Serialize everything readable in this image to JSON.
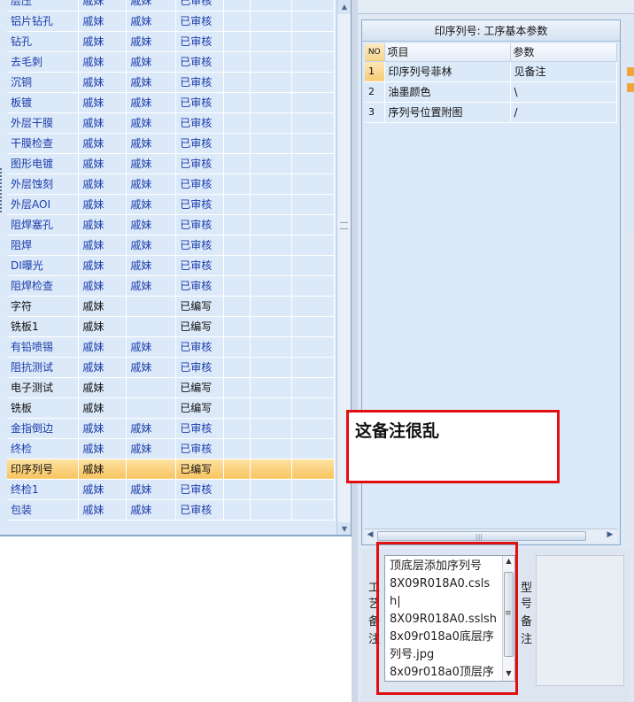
{
  "process_table": {
    "rows": [
      {
        "name": "层压",
        "c2": "戚妹",
        "c3": "戚妹",
        "status": "已审核",
        "kind": "approved",
        "selected": false
      },
      {
        "name": "铝片钻孔",
        "c2": "戚妹",
        "c3": "戚妹",
        "status": "已审核",
        "kind": "approved",
        "selected": false
      },
      {
        "name": "钻孔",
        "c2": "戚妹",
        "c3": "戚妹",
        "status": "已审核",
        "kind": "approved",
        "selected": false
      },
      {
        "name": "去毛刺",
        "c2": "戚妹",
        "c3": "戚妹",
        "status": "已审核",
        "kind": "approved",
        "selected": false
      },
      {
        "name": "沉铜",
        "c2": "戚妹",
        "c3": "戚妹",
        "status": "已审核",
        "kind": "approved",
        "selected": false
      },
      {
        "name": "板镀",
        "c2": "戚妹",
        "c3": "戚妹",
        "status": "已审核",
        "kind": "approved",
        "selected": false
      },
      {
        "name": "外层干膜",
        "c2": "戚妹",
        "c3": "戚妹",
        "status": "已审核",
        "kind": "approved",
        "selected": false
      },
      {
        "name": "干膜检查",
        "c2": "戚妹",
        "c3": "戚妹",
        "status": "已审核",
        "kind": "approved",
        "selected": false
      },
      {
        "name": "图形电镀",
        "c2": "戚妹",
        "c3": "戚妹",
        "status": "已审核",
        "kind": "approved",
        "selected": false
      },
      {
        "name": "外层蚀刻",
        "c2": "戚妹",
        "c3": "戚妹",
        "status": "已审核",
        "kind": "approved",
        "selected": false
      },
      {
        "name": "外层AOI",
        "c2": "戚妹",
        "c3": "戚妹",
        "status": "已审核",
        "kind": "approved",
        "selected": false
      },
      {
        "name": "阻焊塞孔",
        "c2": "戚妹",
        "c3": "戚妹",
        "status": "已审核",
        "kind": "approved",
        "selected": false
      },
      {
        "name": "阻焊",
        "c2": "戚妹",
        "c3": "戚妹",
        "status": "已审核",
        "kind": "approved",
        "selected": false
      },
      {
        "name": "DI曝光",
        "c2": "戚妹",
        "c3": "戚妹",
        "status": "已审核",
        "kind": "approved",
        "selected": false
      },
      {
        "name": "阻焊检查",
        "c2": "戚妹",
        "c3": "戚妹",
        "status": "已审核",
        "kind": "approved",
        "selected": false
      },
      {
        "name": "字符",
        "c2": "戚妹",
        "c3": "",
        "status": "已编写",
        "kind": "written",
        "selected": false
      },
      {
        "name": "铣板1",
        "c2": "戚妹",
        "c3": "",
        "status": "已编写",
        "kind": "written",
        "selected": false
      },
      {
        "name": "有铅喷锡",
        "c2": "戚妹",
        "c3": "戚妹",
        "status": "已审核",
        "kind": "approved",
        "selected": false
      },
      {
        "name": "阻抗测试",
        "c2": "戚妹",
        "c3": "戚妹",
        "status": "已审核",
        "kind": "approved",
        "selected": false
      },
      {
        "name": "电子测试",
        "c2": "戚妹",
        "c3": "",
        "status": "已编写",
        "kind": "written",
        "selected": false
      },
      {
        "name": "铣板",
        "c2": "戚妹",
        "c3": "",
        "status": "已编写",
        "kind": "written",
        "selected": false
      },
      {
        "name": "金指倒边",
        "c2": "戚妹",
        "c3": "戚妹",
        "status": "已审核",
        "kind": "approved",
        "selected": false
      },
      {
        "name": "终检",
        "c2": "戚妹",
        "c3": "戚妹",
        "status": "已审核",
        "kind": "approved",
        "selected": false
      },
      {
        "name": "印序列号",
        "c2": "戚妹",
        "c3": "",
        "status": "已编写",
        "kind": "written",
        "selected": true
      },
      {
        "name": "终检1",
        "c2": "戚妹",
        "c3": "戚妹",
        "status": "已审核",
        "kind": "approved",
        "selected": false
      },
      {
        "name": "包装",
        "c2": "戚妹",
        "c3": "戚妹",
        "status": "已审核",
        "kind": "approved",
        "selected": false
      }
    ]
  },
  "params_panel": {
    "title": "印序列号: 工序基本参数",
    "headers": {
      "no": "NO",
      "item": "项目",
      "param": "参数"
    },
    "rows": [
      {
        "no": "1",
        "item": "印序列号菲林",
        "param": "见备注",
        "active": true
      },
      {
        "no": "2",
        "item": "油墨颜色",
        "param": "\\",
        "active": false
      },
      {
        "no": "3",
        "item": "序列号位置附图",
        "param": "/",
        "active": false
      }
    ]
  },
  "form": {
    "left_labels": [
      "工",
      "艺",
      "备",
      "注"
    ],
    "right_labels": [
      "型",
      "号",
      "备",
      "注"
    ],
    "notes_text": "顶底层添加序列号\n8X09R018A0.csls\nh|\n8X09R018A0.sslsh\n8x09r018a0底层序\n列号.jpg\n8x09r018a0顶层序"
  },
  "annotation": {
    "text": "这备注很乱",
    "color": "#e01010"
  },
  "colors": {
    "approved_text": "#1a3cab",
    "selected_row": "#f7c461",
    "panel_bg": "#dbe9f9"
  }
}
